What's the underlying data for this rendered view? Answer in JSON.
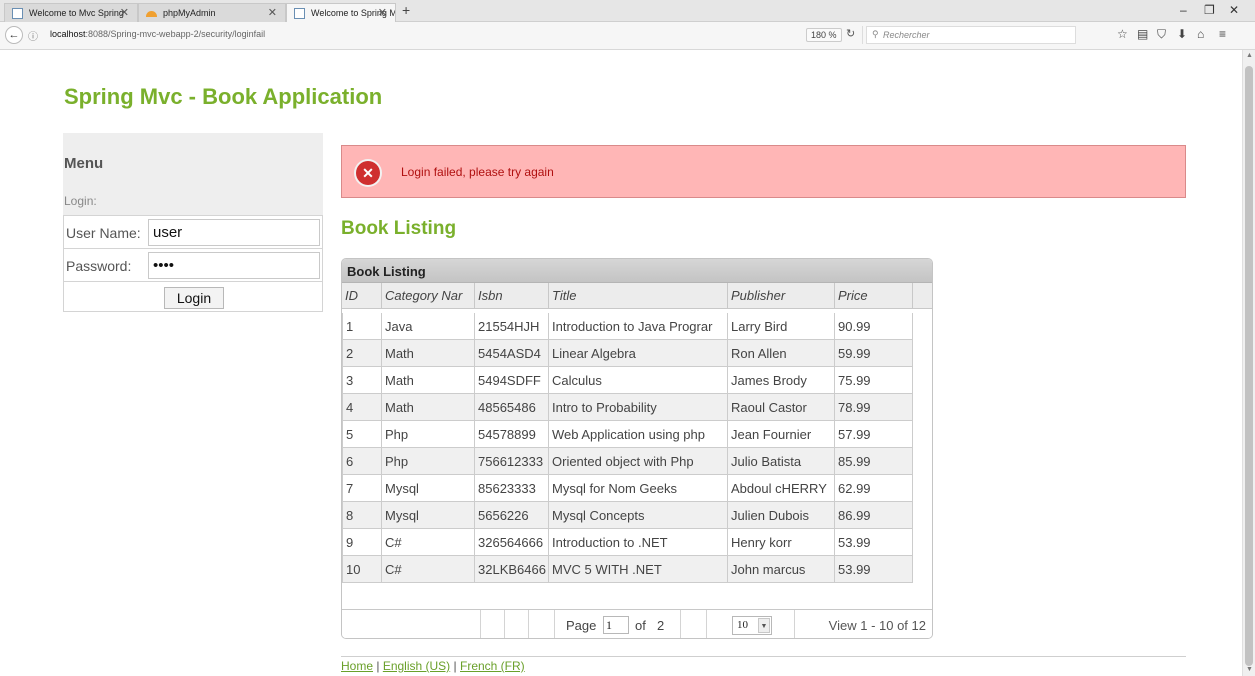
{
  "browser": {
    "tabs": [
      {
        "label": "Welcome to Mvc Spring",
        "active": false
      },
      {
        "label": "phpMyAdmin",
        "active": false
      },
      {
        "label": "Welcome to Spring Mvc",
        "active": true
      }
    ],
    "new_tab_glyph": "+",
    "url_host": "localhost",
    "url_path": ":8088/Spring-mvc-webapp-2/security/loginfail",
    "zoom": "180 %",
    "search_placeholder": "Rechercher",
    "toolbar_icons": [
      "star-icon",
      "reader-icon",
      "pocket-icon",
      "download-icon",
      "home-icon",
      "hamburger-menu-icon"
    ]
  },
  "page": {
    "title": "Spring Mvc - Book Application",
    "accent_color": "#7ab02c"
  },
  "menu": {
    "title": "Menu",
    "login_label": "Login:",
    "username_label": "User Name:",
    "username_value": "user",
    "password_label": "Password:",
    "password_value": "pass",
    "login_button": "Login"
  },
  "error": {
    "message": "Login failed, please try again",
    "icon": "error-x-icon"
  },
  "listing": {
    "heading": "Book Listing",
    "caption": "Book Listing",
    "columns": [
      "ID",
      "Category Nar",
      "Isbn",
      "Title",
      "Publisher",
      "Price"
    ],
    "rows": [
      [
        "1",
        "Java",
        "21554HJH",
        "Introduction to Java Prograr",
        "Larry Bird",
        "90.99"
      ],
      [
        "2",
        "Math",
        "5454ASD4",
        "Linear Algebra",
        "Ron Allen",
        "59.99"
      ],
      [
        "3",
        "Math",
        "5494SDFF",
        "Calculus",
        "James Brody",
        "75.99"
      ],
      [
        "4",
        "Math",
        "48565486",
        "Intro to Probability",
        "Raoul Castor",
        "78.99"
      ],
      [
        "5",
        "Php",
        "54578899",
        "Web Application using php",
        "Jean Fournier",
        "57.99"
      ],
      [
        "6",
        "Php",
        "756612333",
        "Oriented object with Php",
        "Julio Batista",
        "85.99"
      ],
      [
        "7",
        "Mysql",
        "85623333",
        "Mysql for Nom Geeks",
        "Abdoul cHERRY",
        "62.99"
      ],
      [
        "8",
        "Mysql",
        "5656226",
        "Mysql Concepts",
        "Julien Dubois",
        "86.99"
      ],
      [
        "9",
        "C#",
        "326564666",
        "Introduction to .NET",
        "Henry korr",
        "53.99"
      ],
      [
        "10",
        "C#",
        "32LKB6466",
        "MVC 5 WITH .NET",
        "John marcus",
        "53.99"
      ]
    ],
    "pager": {
      "page_label": "Page",
      "page_value": "1",
      "of_label": "of",
      "total_pages": "2",
      "page_size": "10",
      "view_text": "View 1 - 10 of 12"
    }
  },
  "footer": {
    "links": [
      "Home",
      "English (US)",
      "French (FR)"
    ],
    "separator": "|"
  }
}
